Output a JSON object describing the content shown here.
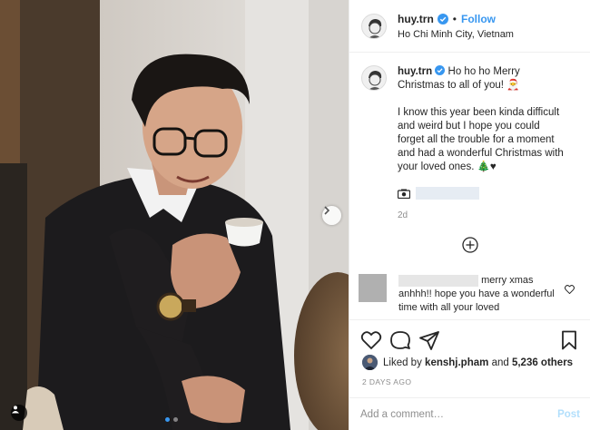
{
  "post": {
    "username": "huy.trn",
    "separator": "•",
    "follow_label": "Follow",
    "location": "Ho Chi Minh City, Vietnam"
  },
  "caption": {
    "username": "huy.trn",
    "line1": "Ho ho ho Merry Christmas to all of you! 🎅",
    "line2": "I know this year been kinda difficult and weird but I hope you could forget all the trouble for a moment and had a wonderful Christmas with your loved ones. 🎄♥",
    "time": "2d"
  },
  "comment": {
    "text_after_name": "merry xmas",
    "text_rest": "anhhh!! hope you have a wonderful time with all your loved"
  },
  "likes": {
    "prefix": "Liked by",
    "liker": "kenshj.pham",
    "middle": "and",
    "count": "5,236 others"
  },
  "posted_ago": "2 DAYS AGO",
  "add_comment": {
    "placeholder": "Add a comment…",
    "post_label": "Post"
  },
  "colors": {
    "accent": "#3897f0",
    "muted": "#8e8e8e",
    "text": "#262626"
  },
  "icons": [
    "verified-badge-icon",
    "heart-icon",
    "comment-icon",
    "share-icon",
    "bookmark-icon",
    "plus-circle-icon",
    "chevron-right-icon",
    "user-tag-icon"
  ]
}
